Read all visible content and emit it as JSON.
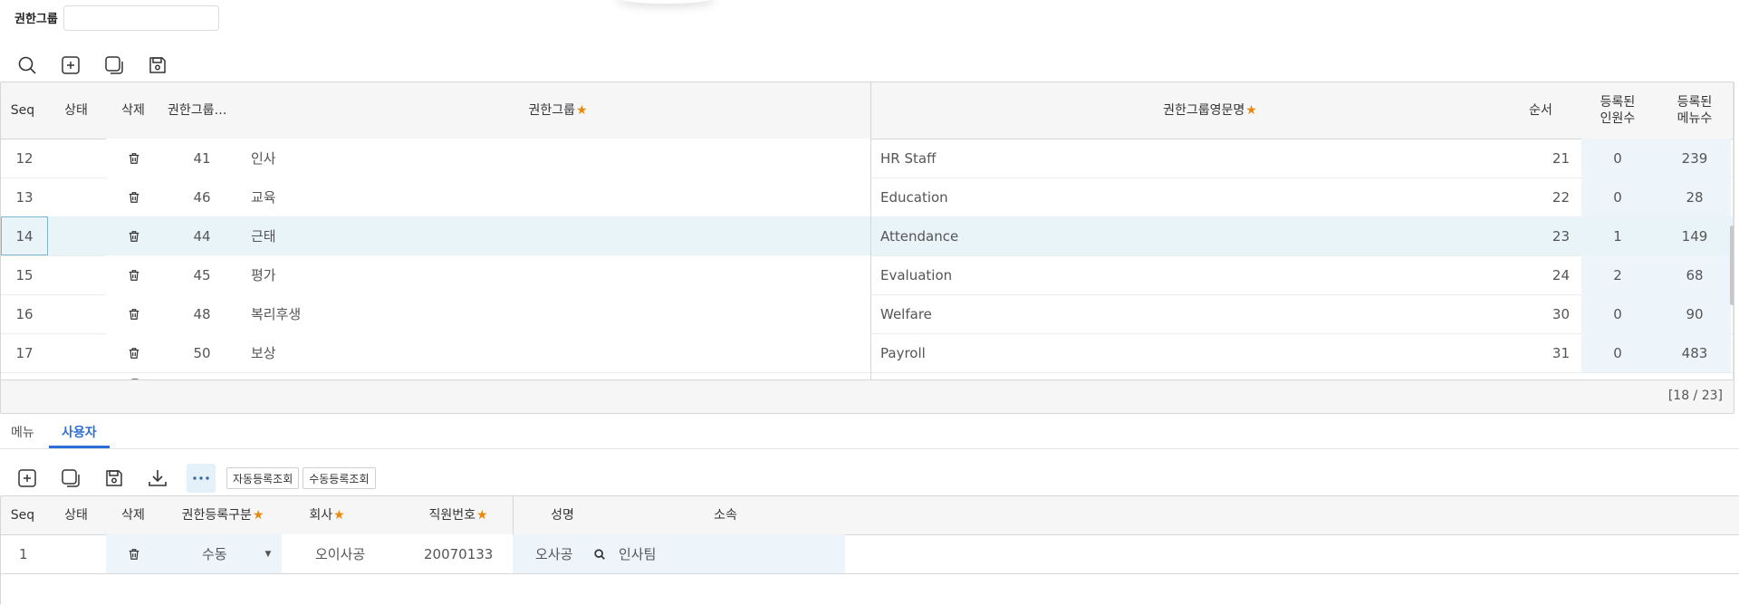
{
  "filter": {
    "label": "권한그룹",
    "value": ""
  },
  "toolbar_top": {
    "icons": [
      "search-icon",
      "add-icon",
      "copy-icon",
      "save-icon"
    ]
  },
  "grid_top": {
    "headers": {
      "seq": "Seq",
      "status": "상태",
      "delete": "삭제",
      "group_code": "권한그룹…",
      "group_name": "권한그룹",
      "group_eng": "권한그룹영문명",
      "order": "순서",
      "users_l1": "등록된",
      "users_l2": "인원수",
      "menus_l1": "등록된",
      "menus_l2": "메뉴수"
    },
    "rows": [
      {
        "seq": "12",
        "code": "41",
        "name": "인사",
        "eng": "HR Staff",
        "order": "21",
        "users": "0",
        "menus": "239"
      },
      {
        "seq": "13",
        "code": "46",
        "name": "교육",
        "eng": "Education",
        "order": "22",
        "users": "0",
        "menus": "28"
      },
      {
        "seq": "14",
        "code": "44",
        "name": "근태",
        "eng": "Attendance",
        "order": "23",
        "users": "1",
        "menus": "149"
      },
      {
        "seq": "15",
        "code": "45",
        "name": "평가",
        "eng": "Evaluation",
        "order": "24",
        "users": "2",
        "menus": "68"
      },
      {
        "seq": "16",
        "code": "48",
        "name": "복리후생",
        "eng": "Welfare",
        "order": "30",
        "users": "0",
        "menus": "90"
      },
      {
        "seq": "17",
        "code": "50",
        "name": "보상",
        "eng": "Payroll",
        "order": "31",
        "users": "0",
        "menus": "483"
      }
    ],
    "selected_seq": "14",
    "footer": "[18 / 23]"
  },
  "tabs": [
    {
      "label": "메뉴",
      "active": false
    },
    {
      "label": "사용자",
      "active": true
    }
  ],
  "toolbar_bottom": {
    "icons": [
      "add-icon",
      "copy-icon",
      "save-icon",
      "download-icon",
      "more-icon"
    ],
    "auto_btn": "자동등록조회",
    "manual_btn": "수동등록조회"
  },
  "grid_bottom": {
    "headers": {
      "seq": "Seq",
      "status": "상태",
      "delete": "삭제",
      "reg_type": "권한등록구분",
      "company": "회사",
      "emp_no": "직원번호",
      "name": "성명",
      "dept": "소속"
    },
    "rows": [
      {
        "seq": "1",
        "reg_type": "수동",
        "company": "오이사공",
        "emp_no": "20070133",
        "name": "오사공",
        "dept": "인사팀"
      }
    ]
  },
  "colors": {
    "accent": "#2d6ed6",
    "required_star": "#e8890c",
    "selected_row": "#e9f4f9"
  }
}
